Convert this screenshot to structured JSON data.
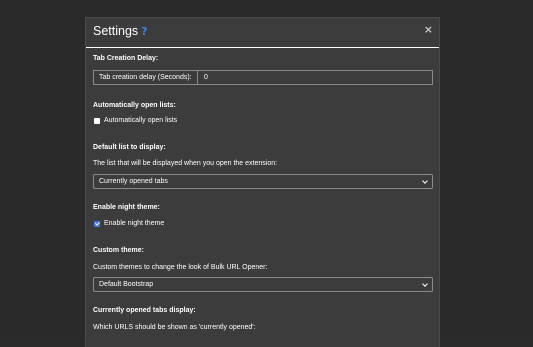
{
  "modal": {
    "title": "Settings",
    "help_icon": "?",
    "close_icon": "×"
  },
  "tab_delay": {
    "title": "Tab Creation Delay:",
    "addon_label": "Tab creation delay (Seconds):",
    "value": "0"
  },
  "auto_open": {
    "title": "Automatically open lists:",
    "checkbox_label": "Automatically open lists",
    "checked": false
  },
  "default_list": {
    "title": "Default list to display:",
    "description": "The list that will be displayed when you open the extension:",
    "selected": "Currently opened tabs"
  },
  "night_theme": {
    "title": "Enable night theme:",
    "checkbox_label": "Enable night theme",
    "checked": true
  },
  "custom_theme": {
    "title": "Custom theme:",
    "description": "Custom themes to change the look of Bulk URL Opener:",
    "selected": "Default Bootstrap"
  },
  "opened_tabs_display": {
    "title": "Currently opened tabs display:",
    "description": "Which URLS should be shown as 'currently opened':"
  },
  "colors": {
    "accent": "#3d7ae0",
    "modal_bg": "#3c3c3c",
    "page_bg": "#2a2a2a"
  }
}
